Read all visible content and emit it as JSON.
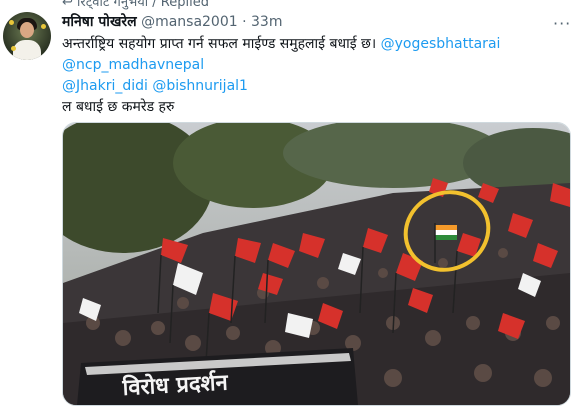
{
  "context": {
    "replied_label": "रिट्वीट गर्नुभयो / Replied"
  },
  "tweet": {
    "display_name": "मनिषा पोखरेल",
    "handle": "@mansa2001",
    "separator": "·",
    "time": "33m",
    "more_icon": "more-horizontal-icon",
    "text_line1": "अन्तर्राष्ट्रिय सहयोग प्राप्त गर्न सफल माईण्ड समुहलाई बधाई छ।",
    "mentions_line1": "@yogesbhattarai",
    "mentions_line2": "@ncp_madhavnepal",
    "mentions_line3a": "@Jhakri_didi",
    "mentions_line3b": "@bishnurijal1",
    "text_line4": "ल बधाई छ कमरेड हरु",
    "banner_text": "विरोध प्रदर्शन"
  },
  "colors": {
    "mention": "#1d9bf0",
    "highlight": "#f2c12e",
    "flag_red": "#d6312b"
  }
}
